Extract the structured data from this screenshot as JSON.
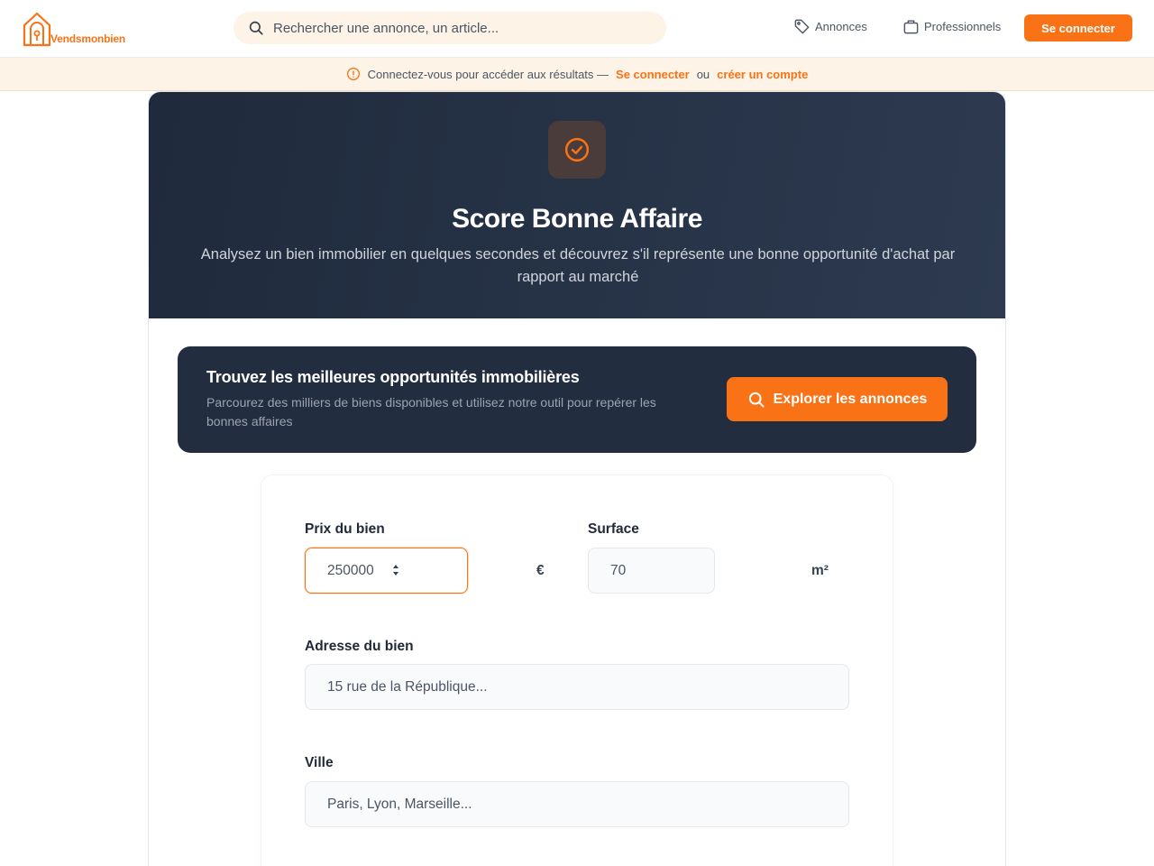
{
  "header": {
    "logo_text": "Vendsmonbien",
    "search_placeholder": "Rechercher une annonce, un article...",
    "nav": {
      "annonces": "Annonces",
      "professionnels": "Professionnels"
    },
    "login_button": "Se connecter"
  },
  "notice": {
    "text": "Connectez-vous pour accéder aux résultats —",
    "login_link": "Se connecter",
    "or": "ou",
    "signup_link": "créer un compte"
  },
  "hero": {
    "title": "Score Bonne Affaire",
    "subtitle": "Analysez un bien immobilier en quelques secondes et découvrez s'il représente une bonne opportunité d'achat par rapport au marché"
  },
  "promo": {
    "title": "Trouvez les meilleures opportunités immobilières",
    "subtitle": "Parcourez des milliers de biens disponibles et utilisez notre outil pour repérer les bonnes affaires",
    "button": "Explorer les annonces"
  },
  "form": {
    "price": {
      "label": "Prix du bien",
      "value": "250000",
      "unit": "€"
    },
    "surface": {
      "label": "Surface",
      "placeholder": "70",
      "unit": "m²"
    },
    "address": {
      "label": "Adresse du bien",
      "placeholder": "15 rue de la République..."
    },
    "city": {
      "label": "Ville",
      "placeholder": "Paris, Lyon, Marseille..."
    }
  },
  "colors": {
    "accent": "#f97316",
    "hero_bg": "#1f2a3c",
    "notice_bg": "#fdf3e7"
  }
}
